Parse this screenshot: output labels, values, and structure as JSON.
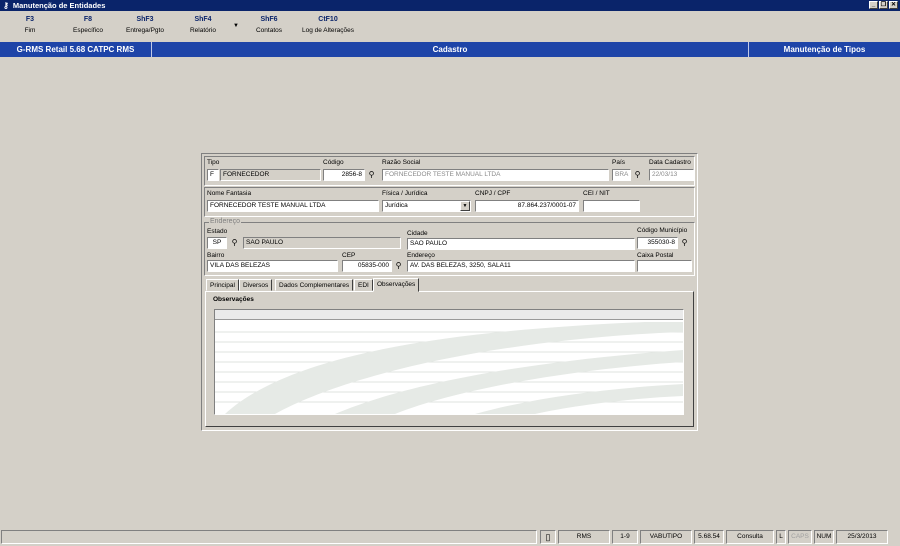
{
  "window": {
    "title": "Manutenção de Entidades",
    "icon": "key-icon"
  },
  "toolbar": [
    {
      "key": "F3",
      "label": "Fim"
    },
    {
      "key": "F8",
      "label": "Específico"
    },
    {
      "key": "ShF3",
      "label": "Entrega/Pgto"
    },
    {
      "key": "ShF4",
      "label": "Relatório"
    },
    {
      "key": "ShF6",
      "label": "Contatos"
    },
    {
      "key": "CtF10",
      "label": "Log de Alterações"
    }
  ],
  "header": {
    "system": "G-RMS Retail 5.68 CATPC RMS",
    "screen": "Cadastro",
    "module": "Manutenção de Tipos"
  },
  "form": {
    "tipo": {
      "label": "Tipo",
      "code": "F",
      "desc": "FORNECEDOR"
    },
    "codigo": {
      "label": "Código",
      "value": "2856-8"
    },
    "razao": {
      "label": "Razão Social",
      "value": "FORNECEDOR TESTE MANUAL LTDA"
    },
    "pais": {
      "label": "País",
      "value": "BRA"
    },
    "data_cadastro": {
      "label": "Data Cadastro",
      "value": "22/03/13"
    },
    "nome_fantasia": {
      "label": "Nome Fantasia",
      "value": "FORNECEDOR TESTE MANUAL LTDA"
    },
    "fisica_juridica": {
      "label": "Física / Jurídica",
      "value": "Jurídica"
    },
    "cnpj": {
      "label": "CNPJ / CPF",
      "value": "87.864.237/0001-07"
    },
    "cei": {
      "label": "CEI / NIT",
      "value": ""
    },
    "endereco_legend": "Endereço",
    "estado": {
      "label": "Estado",
      "uf": "SP",
      "name": "SAO PAULO"
    },
    "cidade": {
      "label": "Cidade",
      "value": "SAO PAULO"
    },
    "cod_municipio": {
      "label": "Código Município",
      "value": "355030-8"
    },
    "bairro": {
      "label": "Bairro",
      "value": "VILA DAS BELEZAS"
    },
    "cep": {
      "label": "CEP",
      "value": "05835-000"
    },
    "endereco": {
      "label": "Endereço",
      "value": "AV. DAS BELEZAS, 3250, SALA11"
    },
    "caixa_postal": {
      "label": "Caixa Postal",
      "value": ""
    }
  },
  "tabs": [
    "Principal",
    "Diversos",
    "Dados Complementares",
    "EDI",
    "Observações"
  ],
  "active_tab": "Observações",
  "observacoes": {
    "label": "Observações",
    "value": ""
  },
  "statusbar": {
    "db": "RMS",
    "page": "1-9",
    "program": "VABUTIPO",
    "version": "5.68.54",
    "mode": "Consulta",
    "l": "L",
    "caps": "CAPS",
    "num": "NUM",
    "date": "25/3/2013"
  }
}
